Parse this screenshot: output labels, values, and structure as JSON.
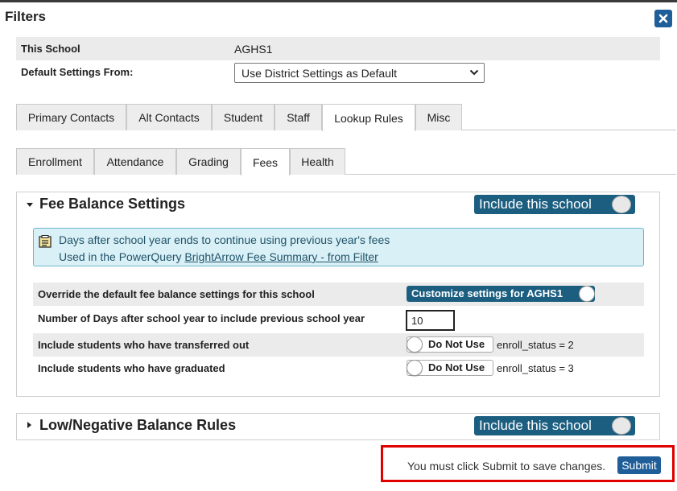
{
  "window": {
    "title": "Filters",
    "close_icon": "close-icon"
  },
  "school": {
    "label": "This School",
    "value": "AGHS1"
  },
  "default_settings": {
    "label": "Default Settings From:",
    "selected": "Use District Settings as Default"
  },
  "main_tabs": [
    {
      "label": "Primary Contacts",
      "active": false
    },
    {
      "label": "Alt Contacts",
      "active": false
    },
    {
      "label": "Student",
      "active": false
    },
    {
      "label": "Staff",
      "active": false
    },
    {
      "label": "Lookup Rules",
      "active": true
    },
    {
      "label": "Misc",
      "active": false
    }
  ],
  "sub_tabs": [
    {
      "label": "Enrollment",
      "active": false
    },
    {
      "label": "Attendance",
      "active": false
    },
    {
      "label": "Grading",
      "active": false
    },
    {
      "label": "Fees",
      "active": true
    },
    {
      "label": "Health",
      "active": false
    }
  ],
  "fee_panel": {
    "title": "Fee Balance Settings",
    "include_toggle": "Include this school",
    "info_line1": "Days after school year ends to continue using previous year's fees",
    "info_prefix": "Used in the PowerQuery",
    "info_link": "BrightArrow Fee Summary - from Filter",
    "rows": {
      "override": {
        "label": "Override the default fee balance settings for this school",
        "toggle": "Customize settings for AGHS1"
      },
      "days": {
        "label": "Number of Days after school year to include previous school year",
        "value": "10"
      },
      "transferred": {
        "label": "Include students who have transferred out",
        "toggle": "Do Not Use",
        "note": "enroll_status = 2"
      },
      "graduated": {
        "label": "Include students who have graduated",
        "toggle": "Do Not Use",
        "note": "enroll_status = 3"
      }
    }
  },
  "low_balance_panel": {
    "title": "Low/Negative Balance Rules",
    "include_toggle": "Include this school"
  },
  "footer": {
    "message": "You must click Submit to save changes.",
    "submit_label": "Submit"
  },
  "colors": {
    "accent": "#1b5e80",
    "button": "#1f5e99",
    "highlight_border": "#e00000",
    "info_bg": "#daf0f7"
  }
}
